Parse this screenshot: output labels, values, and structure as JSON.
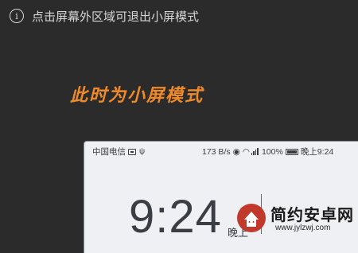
{
  "notice": {
    "text": "点击屏幕外区域可退出小屏模式",
    "icon": "info-circle-icon"
  },
  "caption": {
    "text": "此时为小屏模式",
    "color": "#ef8a2a"
  },
  "status_bar": {
    "carrier": "中国电信",
    "speed": "173 B/s",
    "battery": "100%",
    "time": "晚上9:24",
    "icons": [
      "sim-icon",
      "usb-icon",
      "eye-icon",
      "wifi-icon",
      "signal-icon",
      "battery-icon"
    ]
  },
  "lockscreen": {
    "time": "9:24",
    "ampm": "晚上"
  },
  "watermark": {
    "name": "简约安卓网",
    "url": "www.jylzwj.com"
  }
}
